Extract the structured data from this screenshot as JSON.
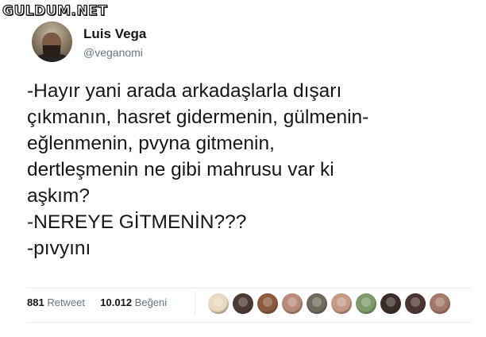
{
  "watermark": {
    "text": "GULDUM.NET"
  },
  "tweet": {
    "author": {
      "name": "Luis Vega",
      "handle": "@veganomi"
    },
    "text_lines": [
      "-Hayır yani arada arkadaşlarla dışarı",
      "çıkmanın, hasret gidermenin, gülmenin-",
      "eğlenmenin, pvyna gitmenin,",
      "dertleşmenin ne gibi mahrusu var ki",
      "aşkım?",
      "-NEREYE GİTMENİN???",
      "-pıvyını"
    ],
    "stats": {
      "retweets_count": "881",
      "retweets_label": "Retweet",
      "likes_count": "10.012",
      "likes_label": "Beğeni"
    },
    "likers": [
      {
        "icon": "liker-avatar",
        "color": "#e8d9c0"
      },
      {
        "icon": "liker-avatar",
        "color": "#4a3a33"
      },
      {
        "icon": "liker-avatar",
        "color": "#8a5a3c"
      },
      {
        "icon": "liker-avatar",
        "color": "#b78a7b"
      },
      {
        "icon": "liker-avatar",
        "color": "#6f6a5c"
      },
      {
        "icon": "liker-avatar",
        "color": "#c59a84"
      },
      {
        "icon": "liker-avatar",
        "color": "#7d9b6a"
      },
      {
        "icon": "liker-avatar",
        "color": "#3a2c26"
      },
      {
        "icon": "liker-avatar",
        "color": "#4b3530"
      },
      {
        "icon": "liker-avatar",
        "color": "#a37868"
      }
    ]
  }
}
